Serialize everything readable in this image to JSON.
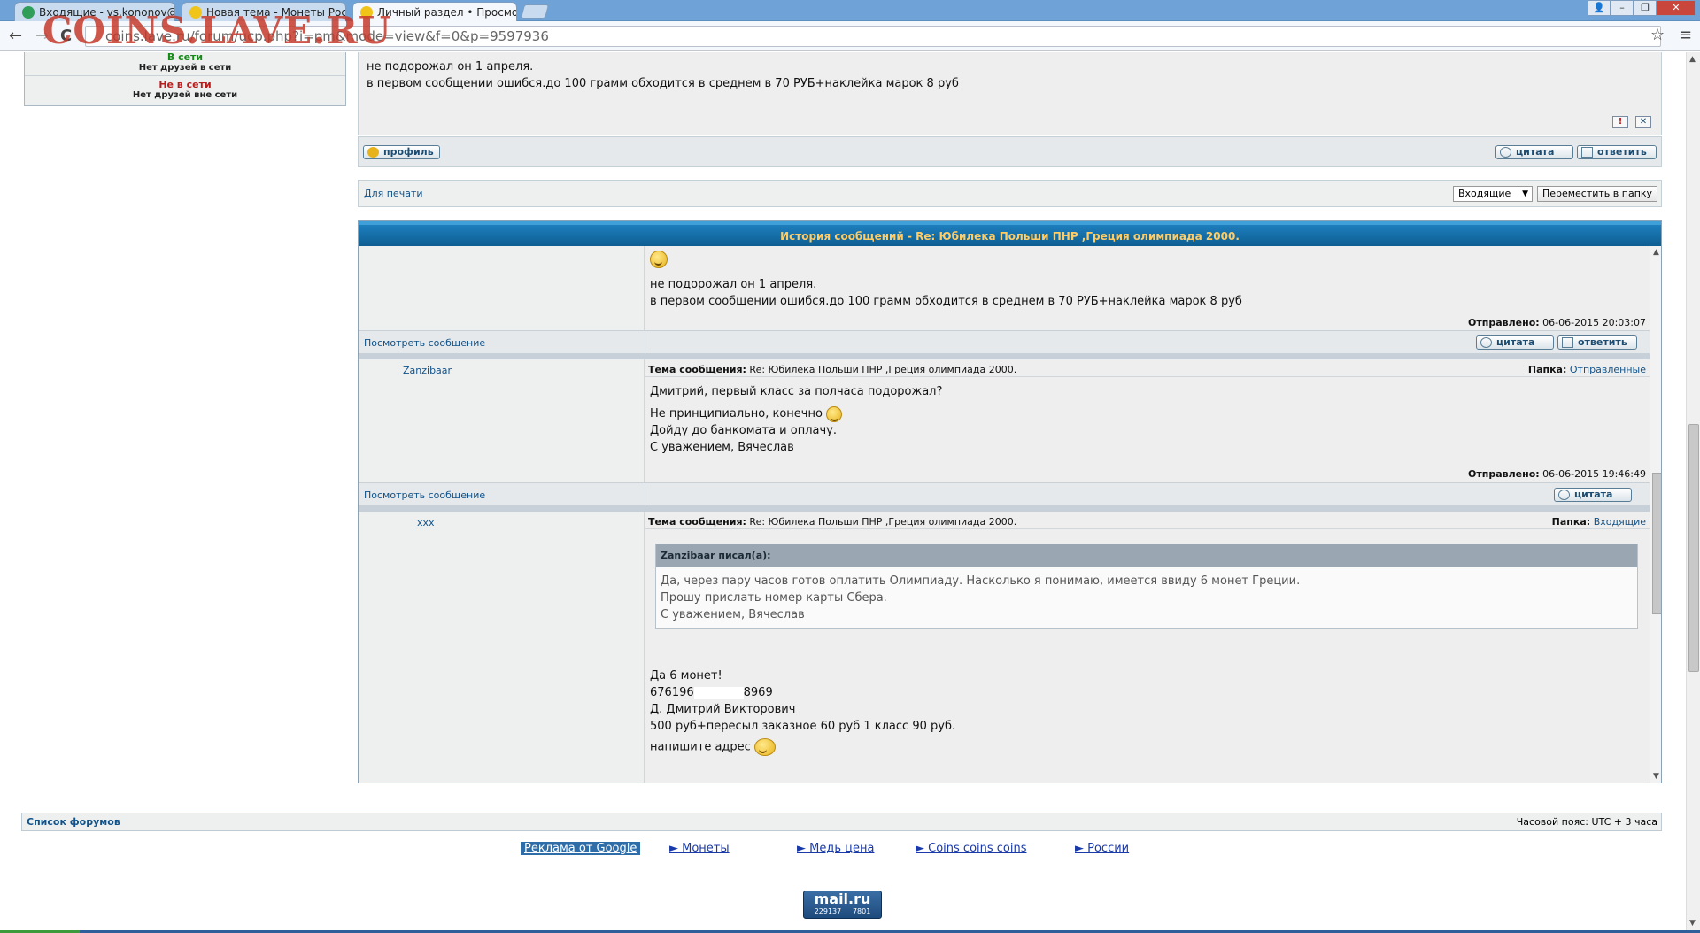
{
  "browser": {
    "tabs": [
      {
        "title": "Входящие - vs.kononov@m",
        "close": "✕"
      },
      {
        "title": "Новая тема - Монеты Росс",
        "close": "✕"
      },
      {
        "title": "Личный раздел • Просмотр",
        "close": "✕"
      }
    ],
    "url": "coins.lave.ru/forum/ucp.php?i=pm&mode=view&f=0&p=9597936",
    "logo": "COINS.LAVE.RU",
    "nav": {
      "back": "←",
      "forward": "→",
      "reload": "C"
    },
    "window_controls": {
      "user": "👤",
      "minimize": "–",
      "restore": "❐",
      "close": "✕"
    },
    "star": "☆",
    "menu": "≡"
  },
  "friends": {
    "online_title": "В сети",
    "online_text": "Нет друзей в сети",
    "offline_title": "Не в сети",
    "offline_text": "Нет друзей вне сети"
  },
  "top_post": {
    "lines": [
      "не подорожал он 1 апреля.",
      "в первом сообщении ошибся.до 100 грамм обходится в среднем в 70 РУБ+наклейка марок 8 руб"
    ],
    "report_icon": "!",
    "delete_icon": "✕",
    "profile_label": "профиль",
    "quote_label": "цитата",
    "reply_label": "ответить"
  },
  "print_bar": {
    "print_label": "Для печати",
    "folder_select": "Входящие",
    "move_label": "Переместить в папку"
  },
  "history": {
    "title": "История сообщений - Re: Юбилека Польши ПНР ,Греция олимпиада 2000.",
    "labels": {
      "view_message": "Посмотреть сообщение",
      "subject": "Тема сообщения:",
      "folder": "Папка:",
      "sent": "Отправлено:",
      "quote": "цитата",
      "reply": "ответить"
    },
    "msg1": {
      "lines": [
        "не подорожал он 1 апреля.",
        "в первом сообщении ошибся.до 100 грамм обходится в среднем в 70 РУБ+наклейка марок 8 руб"
      ],
      "sent": "06-06-2015 20:03:07"
    },
    "msg2": {
      "author": "Zanzibaar",
      "subject": "Re: Юбилека Польши ПНР ,Греция олимпиада 2000.",
      "folder": "Отправленные",
      "lines": [
        "Дмитрий, первый класс за полчаса подорожал?",
        "Не принципиально, конечно",
        "Дойду до банкомата и оплачу.",
        "С уважением, Вячеслав"
      ],
      "sent": "06-06-2015 19:46:49"
    },
    "msg3": {
      "author": "xxx",
      "subject": "Re: Юбилека Польши ПНР ,Греция олимпиада 2000.",
      "folder": "Входящие",
      "quote_author": "Zanzibaar писал(а):",
      "quote_lines": [
        "Да, через пару часов готов оплатить Олимпиаду. Насколько я понимаю, имеется ввиду 6 монет Греции.",
        "Прошу прислать номер карты Сбера.",
        "С уважением, Вячеслав"
      ],
      "lines": [
        "Да 6 монет!",
        "676196",
        "8969",
        "Д. Дмитрий Викторович",
        "500 руб+пересыл заказное 60 руб 1 класс 90 руб.",
        "напишите адрес"
      ]
    }
  },
  "footer": {
    "forum_list": "Список форумов",
    "timezone": "Часовой пояс: UTC + 3 часа",
    "ads_label": "Реклама от Google",
    "ads": [
      "► Монеты",
      "► Медь цена",
      "► Coins coins coins",
      "► России"
    ],
    "mailru": {
      "brand": "mail.ru",
      "left": "229137",
      "right": "7801"
    }
  },
  "colors": {
    "accent": "#105289",
    "header": "#0e5e92",
    "online": "#168a16",
    "offline": "#b81d1d"
  }
}
